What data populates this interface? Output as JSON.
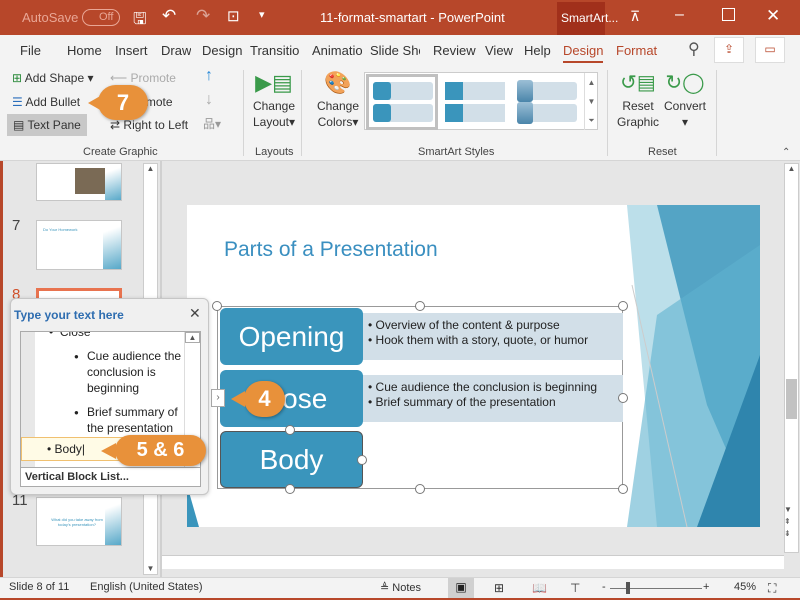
{
  "titlebar": {
    "autosave": "AutoSave",
    "autosave_state": "Off",
    "document_title": "11-format-smartart  -  PowerPoint",
    "contextual_tab": "SmartArt..."
  },
  "tabs": [
    "File",
    "Home",
    "Insert",
    "Draw",
    "Design",
    "Transitio",
    "Animatio",
    "Slide Sho",
    "Review",
    "View",
    "Help",
    "Design",
    "Format"
  ],
  "active_tab": "Design",
  "ribbon": {
    "create_graphic": {
      "add_shape": "Add Shape",
      "add_bullet": "Add Bullet",
      "text_pane": "Text Pane",
      "promote": "Promote",
      "demote": "Demote",
      "right_to_left": "Right to Left",
      "label": "Create Graphic"
    },
    "layouts": {
      "change_layout_1": "Change",
      "change_layout_2": "Layout",
      "label": "Layouts"
    },
    "smartart_styles": {
      "change_colors_1": "Change",
      "change_colors_2": "Colors",
      "label": "SmartArt Styles"
    },
    "reset": {
      "reset_1": "Reset",
      "reset_2": "Graphic",
      "convert": "Convert",
      "label": "Reset"
    }
  },
  "slides_pane": {
    "numbers": [
      "7",
      "8",
      "11"
    ],
    "slide7_title": "Do Your Homework",
    "slide11_text": "What did you take away from today's presentation?"
  },
  "slide": {
    "title": "Parts of a Presentation",
    "blocks": [
      {
        "label": "Opening",
        "bullets": [
          "Overview of the content & purpose",
          "Hook them with a story, quote, or humor"
        ]
      },
      {
        "label": "Close",
        "bullets": [
          "Cue audience the conclusion is beginning",
          "Brief summary of the presentation"
        ]
      },
      {
        "label": "Body",
        "bullets": []
      }
    ]
  },
  "text_pane": {
    "title": "Type your text here",
    "items": [
      "Close",
      "Cue audience the conclusion is beginning",
      "Brief summary of the presentation",
      "Body"
    ],
    "footer": "Vertical Block List..."
  },
  "callouts": {
    "c7": "7",
    "c4": "4",
    "c56": "5 & 6"
  },
  "status": {
    "slide": "Slide 8 of 11",
    "language": "English (United States)",
    "notes": "Notes",
    "zoom": "45%"
  },
  "zoom_percent": 45,
  "colors": {
    "accent": "#b7472a",
    "smartart": "#3a95bc",
    "callout": "#e8913a"
  }
}
